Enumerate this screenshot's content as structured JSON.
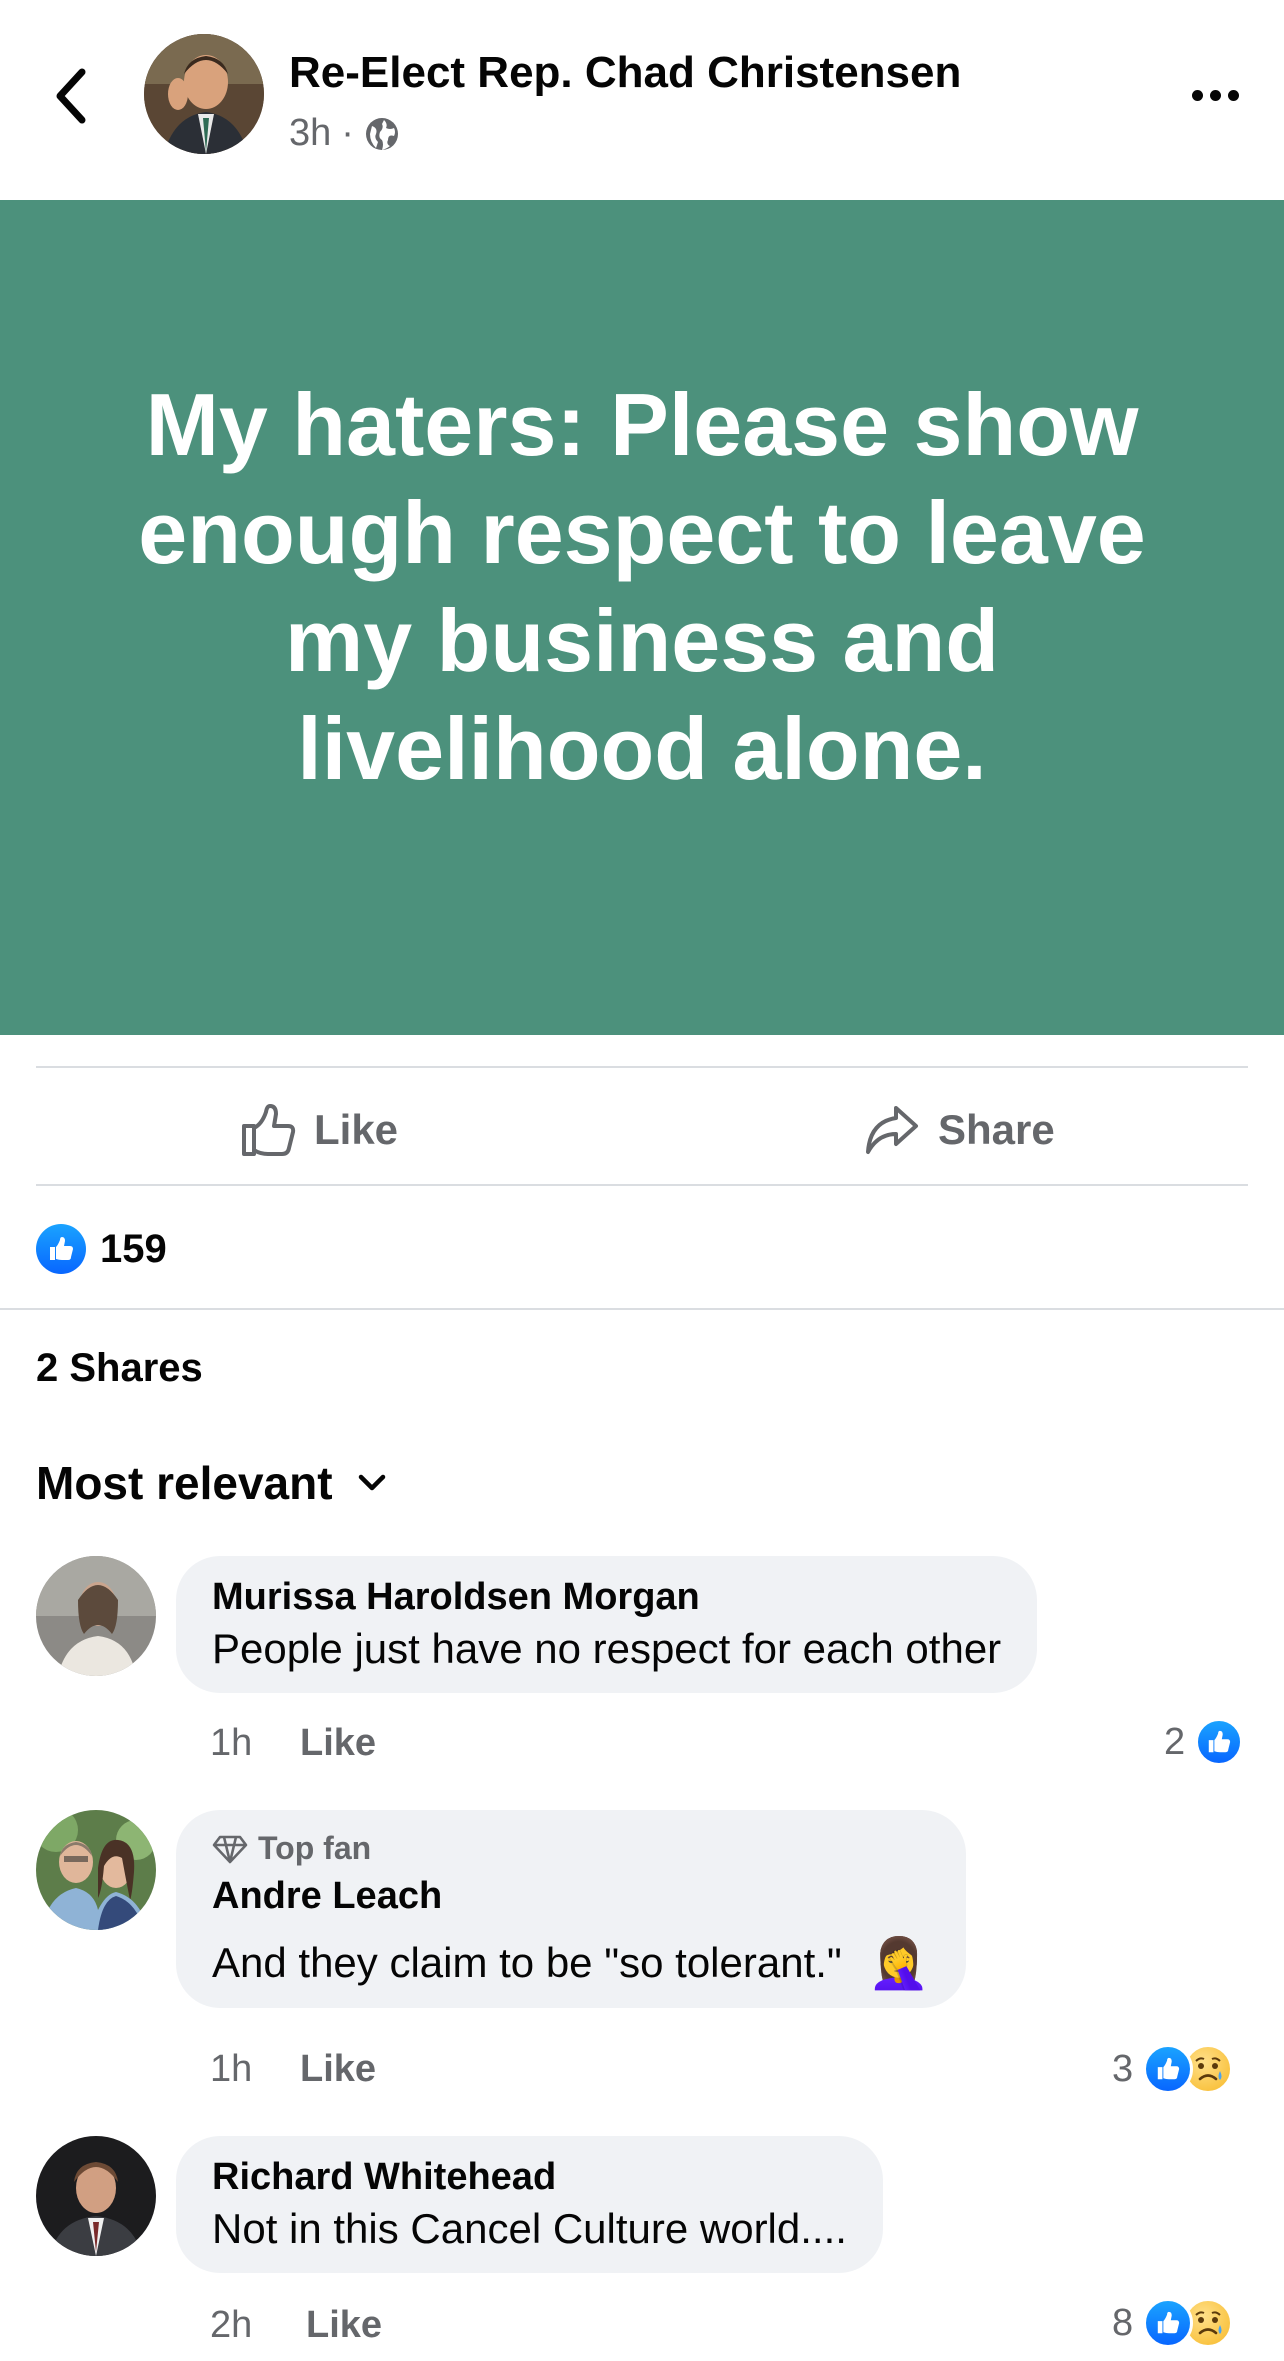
{
  "header": {
    "page_name": "Re-Elect Rep. Chad Christensen",
    "time": "3h",
    "separator": "·",
    "audience_icon": "globe-icon",
    "back_icon": "chevron-left-icon",
    "more_icon": "more-horizontal-icon"
  },
  "post": {
    "text": "My haters: Please show enough respect to leave my business and livelihood alone.",
    "background_color": "#4c917c"
  },
  "actions": {
    "like_label": "Like",
    "share_label": "Share"
  },
  "reactions": {
    "count": "159",
    "shares": "2 Shares"
  },
  "sort": {
    "label": "Most relevant"
  },
  "comments": [
    {
      "name": "Murissa Haroldsen Morgan",
      "text": "People just have no respect for each other",
      "time": "1h",
      "like_label": "Like",
      "reaction_count": "2",
      "reactions": [
        "like"
      ]
    },
    {
      "badge": "Top fan",
      "name": "Andre Leach",
      "text": "And they claim to be \"so tolerant.\"",
      "emoji": "🤦‍♀️",
      "time": "1h",
      "like_label": "Like",
      "reaction_count": "3",
      "reactions": [
        "like",
        "sad"
      ]
    },
    {
      "name": "Richard Whitehead",
      "text": "Not in this Cancel Culture world....",
      "time": "2h",
      "like_label": "Like",
      "reaction_count": "8",
      "reactions": [
        "like",
        "sad"
      ]
    }
  ]
}
